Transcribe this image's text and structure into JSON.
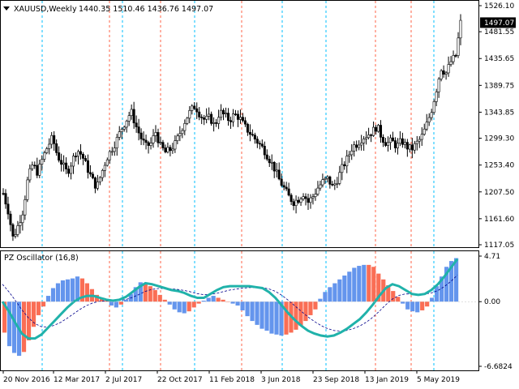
{
  "header": {
    "symbol": "XAUUSD,Weekly",
    "ohlc": "1440.35 1510.46 1436.76 1497.07",
    "menu_icon": "triangle-down-icon"
  },
  "indicator": {
    "label": "PZ Oscillator (16,8)"
  },
  "colors": {
    "bull_bar": "#6495ed",
    "bear_bar": "#fa6e55",
    "osc_line": "#20b2aa",
    "signal_line": "#00008b",
    "vline_blue": "#00bfff",
    "vline_red": "#ff6347",
    "candle": "#000000"
  },
  "chart_data": [
    {
      "type": "candlestick",
      "title": "XAUUSD,Weekly",
      "y_ticks": [
        "1526.10",
        "1481.55",
        "1435.65",
        "1389.75",
        "1343.85",
        "1299.30",
        "1253.40",
        "1207.50",
        "1161.60",
        "1117.05"
      ],
      "ylim": [
        1117.05,
        1526.1
      ],
      "current_price": "1497.07",
      "x_ticks": [
        "20 Nov 2016",
        "12 Mar 2017",
        "2 Jul 2017",
        "22 Oct 2017",
        "11 Feb 2018",
        "3 Jun 2018",
        "23 Sep 2018",
        "13 Jan 2019",
        "5 May 2019"
      ],
      "close_path": [
        1205,
        1175,
        1128,
        1150,
        1175,
        1230,
        1255,
        1240,
        1265,
        1285,
        1300,
        1270,
        1255,
        1240,
        1260,
        1280,
        1270,
        1250,
        1230,
        1215,
        1240,
        1265,
        1280,
        1295,
        1315,
        1330,
        1345,
        1320,
        1300,
        1285,
        1290,
        1310,
        1285,
        1275,
        1280,
        1290,
        1310,
        1330,
        1345,
        1355,
        1340,
        1330,
        1335,
        1320,
        1345,
        1338,
        1330,
        1340,
        1335,
        1320,
        1310,
        1300,
        1290,
        1280,
        1265,
        1250,
        1230,
        1215,
        1200,
        1190,
        1195,
        1205,
        1190,
        1200,
        1215,
        1225,
        1230,
        1215,
        1230,
        1250,
        1265,
        1285,
        1290,
        1300,
        1305,
        1310,
        1320,
        1300,
        1290,
        1295,
        1285,
        1295,
        1285,
        1280,
        1290,
        1300,
        1320,
        1345,
        1380,
        1420,
        1410,
        1430,
        1440,
        1497
      ]
    },
    {
      "type": "histogram-with-lines",
      "title": "PZ Oscillator (16,8)",
      "y_ticks": [
        "4.71",
        "0.00",
        "-6.6824"
      ],
      "ylim": [
        -6.6824,
        4.71
      ],
      "histogram": [
        -3.2,
        -4.6,
        -5.3,
        -5.6,
        -5.2,
        -4.0,
        -2.6,
        -1.4,
        -0.5,
        0.6,
        1.4,
        1.9,
        2.2,
        2.3,
        2.4,
        2.6,
        2.4,
        1.9,
        1.3,
        0.7,
        0.3,
        0.1,
        -0.4,
        -0.6,
        -0.3,
        0.2,
        0.8,
        1.5,
        2.0,
        1.9,
        1.6,
        1.2,
        0.7,
        0.2,
        -0.3,
        -0.8,
        -1.1,
        -1.2,
        -1.0,
        -0.6,
        -0.2,
        0.1,
        0.4,
        0.6,
        0.4,
        0.2,
        0.0,
        -0.2,
        -0.4,
        -0.9,
        -1.5,
        -2.0,
        -2.4,
        -2.8,
        -3.0,
        -3.3,
        -3.4,
        -3.5,
        -3.4,
        -3.2,
        -2.9,
        -2.5,
        -2.0,
        -1.4,
        -0.8,
        0.3,
        1.0,
        1.5,
        1.9,
        2.3,
        2.7,
        3.1,
        3.5,
        3.7,
        3.8,
        3.8,
        3.6,
        2.9,
        2.3,
        1.7,
        1.1,
        0.5,
        -0.2,
        -0.8,
        -1.0,
        -1.1,
        -0.9,
        -0.5,
        0.4,
        1.6,
        2.6,
        3.6,
        4.2,
        4.5
      ],
      "oscillator_line": [
        0.0,
        -1.0,
        -2.2,
        -3.3,
        -3.8,
        -3.8,
        -3.4,
        -2.7,
        -2.0,
        -1.3,
        -0.6,
        0.0,
        0.4,
        0.6,
        0.6,
        0.4,
        0.2,
        0.1,
        0.2,
        0.5,
        1.0,
        1.5,
        1.9,
        1.8,
        1.6,
        1.4,
        1.2,
        1.1,
        0.9,
        0.6,
        0.4,
        0.4,
        0.8,
        1.2,
        1.5,
        1.6,
        1.6,
        1.6,
        1.6,
        1.5,
        1.4,
        1.0,
        0.4,
        -0.4,
        -1.2,
        -1.9,
        -2.5,
        -3.0,
        -3.3,
        -3.5,
        -3.6,
        -3.5,
        -3.2,
        -2.8,
        -2.3,
        -1.8,
        -1.1,
        -0.3,
        0.6,
        1.4,
        1.8,
        1.6,
        1.2,
        0.8,
        0.7,
        0.8,
        1.2,
        1.8,
        2.6,
        3.5,
        4.4
      ]
    }
  ]
}
